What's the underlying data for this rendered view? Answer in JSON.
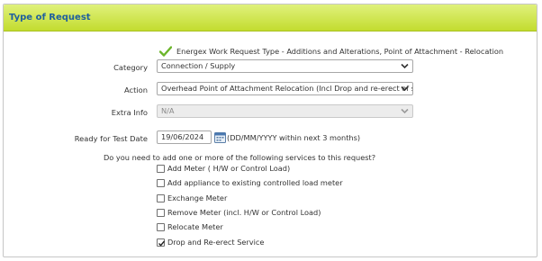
{
  "header": {
    "title": "Type of Request"
  },
  "info": {
    "text": "Energex Work Request Type - Additions and Alterations, Point of Attachment - Relocation"
  },
  "fields": {
    "category": {
      "label": "Category",
      "value": "Connection / Supply"
    },
    "action": {
      "label": "Action",
      "value": "Overhead Point of Attachment Relocation (Incl Drop and re-erect of servce)"
    },
    "extra_info": {
      "label": "Extra Info",
      "value": "N/A"
    },
    "test_date": {
      "label": "Ready for Test Date",
      "value": "19/06/2024",
      "hint": "(DD/MM/YYYY within next 3 months)"
    }
  },
  "services": {
    "question": "Do you need to add one or more of the following services to this request?",
    "options": [
      {
        "label": "Add Meter ( H/W or Control Load)",
        "checked": false
      },
      {
        "label": "Add appliance to existing controlled load meter",
        "checked": false
      },
      {
        "label": "Exchange Meter",
        "checked": false
      },
      {
        "label": "Remove Meter (incl. H/W or Control Load)",
        "checked": false
      },
      {
        "label": "Relocate Meter",
        "checked": false
      },
      {
        "label": "Drop and Re-erect Service",
        "checked": true
      }
    ]
  },
  "colors": {
    "header_top": "#dff17c",
    "header_bottom": "#c3dc2f",
    "title": "#1f5f9e",
    "check": "#6bb52a"
  }
}
